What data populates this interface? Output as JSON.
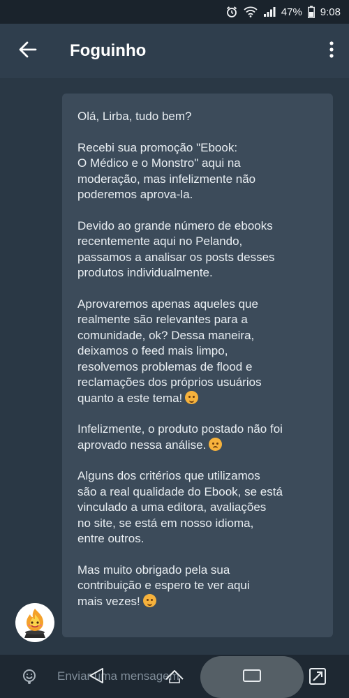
{
  "status_bar": {
    "battery": "47%",
    "time": "9:08"
  },
  "header": {
    "title": "Foguinho"
  },
  "message": {
    "paragraphs": [
      {
        "text": "Olá, Lirba, tudo bem?",
        "emoji": null
      },
      {
        "text": "Recebi sua promoção  \"Ebook:\nO Médico e o Monstro\" aqui na\nmoderação, mas infelizmente não\npoderemos aprova-la.",
        "emoji": null
      },
      {
        "text": "Devido ao grande número de  ebooks\nrecentemente aqui no Pelando,\npassamos a analisar os posts desses\nprodutos individualmente.",
        "emoji": null
      },
      {
        "text": "Aprovaremos apenas aqueles que\nrealmente são relevantes para a\ncomunidade, ok? Dessa maneira,\ndeixamos o feed mais limpo,\nresolvemos problemas de flood e\nreclamações dos próprios usuários\nquanto a este tema!",
        "emoji": "smiling-emoji"
      },
      {
        "text": "Infelizmente, o produto postado não foi\naprovado nessa análise.",
        "emoji": "sad-emoji"
      },
      {
        "text": "Alguns dos critérios que utilizamos\nsão a real qualidade do Ebook, se está\nvinculado a uma editora, avaliações\nno site, se está em nosso idioma,\nentre outros.",
        "emoji": null
      },
      {
        "text": "Mas muito obrigado pela sua\ncontribuição e espero te ver aqui\nmais vezes!",
        "emoji": "grinning-emoji"
      }
    ]
  },
  "input": {
    "placeholder": "Enviar uma mensagem"
  },
  "icons": {
    "back": "arrow-left-icon",
    "menu": "more-vertical-icon",
    "attach": "sticker-icon",
    "nav_back": "nav-back-icon",
    "nav_home": "nav-home-icon",
    "nav_recents": "nav-recents-icon",
    "nav_rotate": "rotate-icon"
  },
  "colors": {
    "bubble": "#3c4b5a",
    "header": "#2f3e4d",
    "background": "#2a3845"
  }
}
